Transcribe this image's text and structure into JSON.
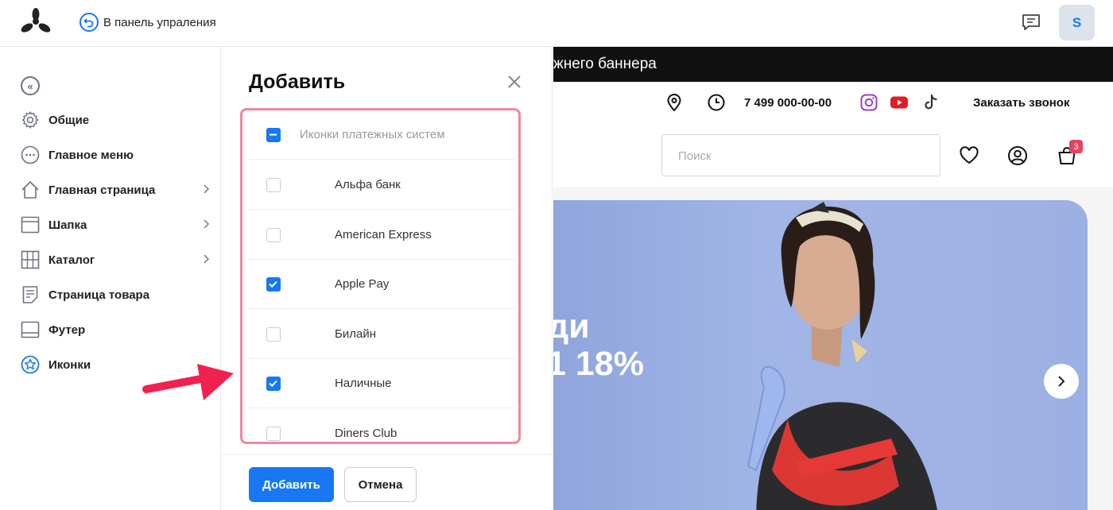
{
  "topbar": {
    "back_label": "В панель упраления",
    "avatar_letter": "S"
  },
  "sidebar": {
    "items": [
      {
        "label": "Общие",
        "icon": "gear-icon"
      },
      {
        "label": "Главное меню",
        "icon": "dots-circle-icon"
      },
      {
        "label": "Главная страница",
        "icon": "home-icon"
      },
      {
        "label": "Шапка",
        "icon": "header-layout-icon"
      },
      {
        "label": "Каталог",
        "icon": "grid-icon"
      },
      {
        "label": "Страница товара",
        "icon": "page-icon"
      },
      {
        "label": "Футер",
        "icon": "footer-layout-icon"
      },
      {
        "label": "Иконки",
        "icon": "star-circle-icon"
      }
    ]
  },
  "modal": {
    "title": "Добавить",
    "group_label": "Иконки платежных систем",
    "items": [
      {
        "label": "Альфа банк",
        "checked": false
      },
      {
        "label": "American Express",
        "checked": false
      },
      {
        "label": "Apple Pay",
        "checked": true
      },
      {
        "label": "Билайн",
        "checked": false
      },
      {
        "label": "Наличные",
        "checked": true
      },
      {
        "label": "Diners Club",
        "checked": false
      }
    ],
    "add_button": "Добавить",
    "cancel_button": "Отмена"
  },
  "preview": {
    "promo_text": "жнего баннера",
    "phone": "7 499 000-00-00",
    "callback": "Заказать звонок",
    "search_placeholder": "Поиск",
    "cart_count": "3",
    "banner_line1": "ди",
    "banner_line2": "1 18%"
  },
  "colors": {
    "accent": "#1877f2",
    "highlight_border": "#f0879f",
    "arrow": "#f0204f",
    "promo_bar": "#111111",
    "badge": "#e94260"
  }
}
